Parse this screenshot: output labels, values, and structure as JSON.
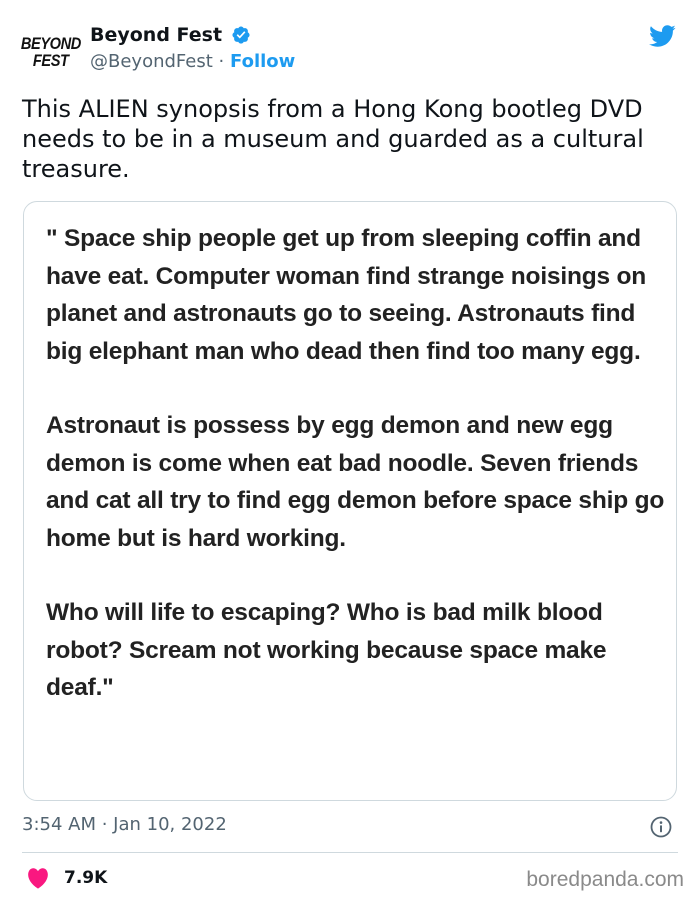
{
  "account": {
    "avatar_line1": "BEYOND",
    "avatar_line2": "FEST",
    "display_name": "Beyond Fest",
    "handle": "@BeyondFest",
    "separator": "·",
    "follow_label": "Follow",
    "verified_icon": "verified-badge-icon"
  },
  "tweet": {
    "text": "This ALIEN synopsis from a Hong Kong bootleg DVD needs to be in a museum and guarded as a cultural treasure.",
    "timestamp": "3:54 AM · Jan 10, 2022",
    "likes": "7.9K"
  },
  "image": {
    "paragraphs": [
      "\" Space ship people get up from sleeping coffin and have eat. Computer woman find strange noisings on planet and astronauts go to seeing. Astronauts find big elephant man who dead then find too many egg.",
      "Astronaut is possess by egg demon and new egg demon is come when eat bad noodle. Seven friends and cat all try to find egg demon before space ship go home but is hard working.",
      "Who will life to escaping? Who is bad milk blood robot? Scream not working because space make deaf.\""
    ]
  },
  "watermark": "boredpanda.com",
  "colors": {
    "accent": "#1d9bf0",
    "heart": "#f91880",
    "secondary_text": "#536471"
  }
}
